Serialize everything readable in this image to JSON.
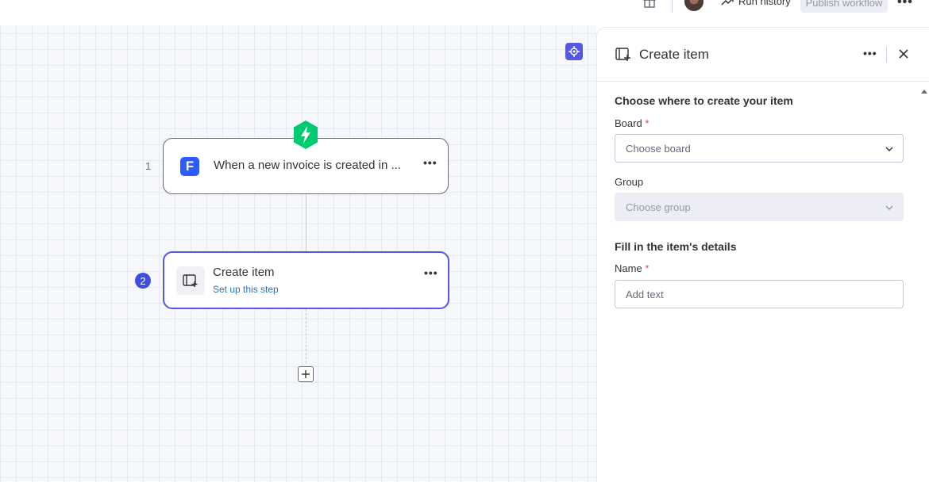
{
  "topbar": {
    "gift_icon": "gift-icon",
    "run_history_label": "Run history",
    "publish_label": "Publish workflow",
    "more_icon": "more-horizontal-icon"
  },
  "canvas": {
    "recenter_icon": "recenter-icon",
    "trigger": {
      "number": "1",
      "title": "When a new invoice is created in ...",
      "app_icon_letter": "F",
      "badge_icon": "lightning-icon",
      "accent": "#00ca72"
    },
    "action": {
      "number": "2",
      "title": "Create item",
      "subtitle": "Set up this step",
      "accent": "#5559df"
    },
    "add_step_icon": "plus-icon"
  },
  "panel": {
    "title": "Create item",
    "section1_title": "Choose where to create your item",
    "board_label": "Board",
    "board_placeholder": "Choose board",
    "group_label": "Group",
    "group_placeholder": "Choose group",
    "section2_title": "Fill in the item's details",
    "name_label": "Name",
    "name_placeholder": "Add text",
    "required_mark": "*"
  }
}
